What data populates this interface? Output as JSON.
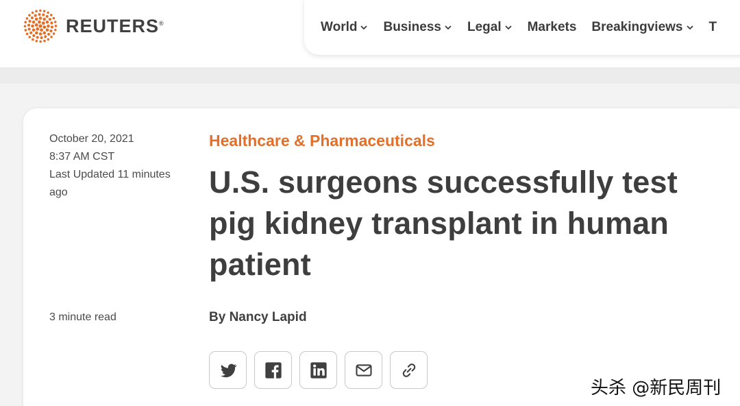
{
  "brand": {
    "logo_text": "REUTERS",
    "registered_mark": "®",
    "accent_color": "#e36f29"
  },
  "nav": {
    "items": [
      {
        "label": "World",
        "has_dropdown": true
      },
      {
        "label": "Business",
        "has_dropdown": true
      },
      {
        "label": "Legal",
        "has_dropdown": true
      },
      {
        "label": "Markets",
        "has_dropdown": false
      },
      {
        "label": "Breakingviews",
        "has_dropdown": true
      },
      {
        "label": "T",
        "has_dropdown": false
      }
    ]
  },
  "article": {
    "date": "October 20, 2021",
    "time": "8:37 AM CST",
    "updated": "Last Updated 11 minutes ago",
    "read_time": "3 minute read",
    "category": "Healthcare & Pharmaceuticals",
    "headline": "U.S. surgeons successfully test pig kidney transplant in human patient",
    "byline_prefix": "By",
    "author": "Nancy Lapid"
  },
  "share": [
    {
      "icon": "twitter-icon",
      "label": "Twitter"
    },
    {
      "icon": "facebook-icon",
      "label": "Facebook"
    },
    {
      "icon": "linkedin-icon",
      "label": "LinkedIn"
    },
    {
      "icon": "email-icon",
      "label": "Email"
    },
    {
      "icon": "link-icon",
      "label": "Link"
    }
  ],
  "watermark": "头杀 @新民周刊"
}
